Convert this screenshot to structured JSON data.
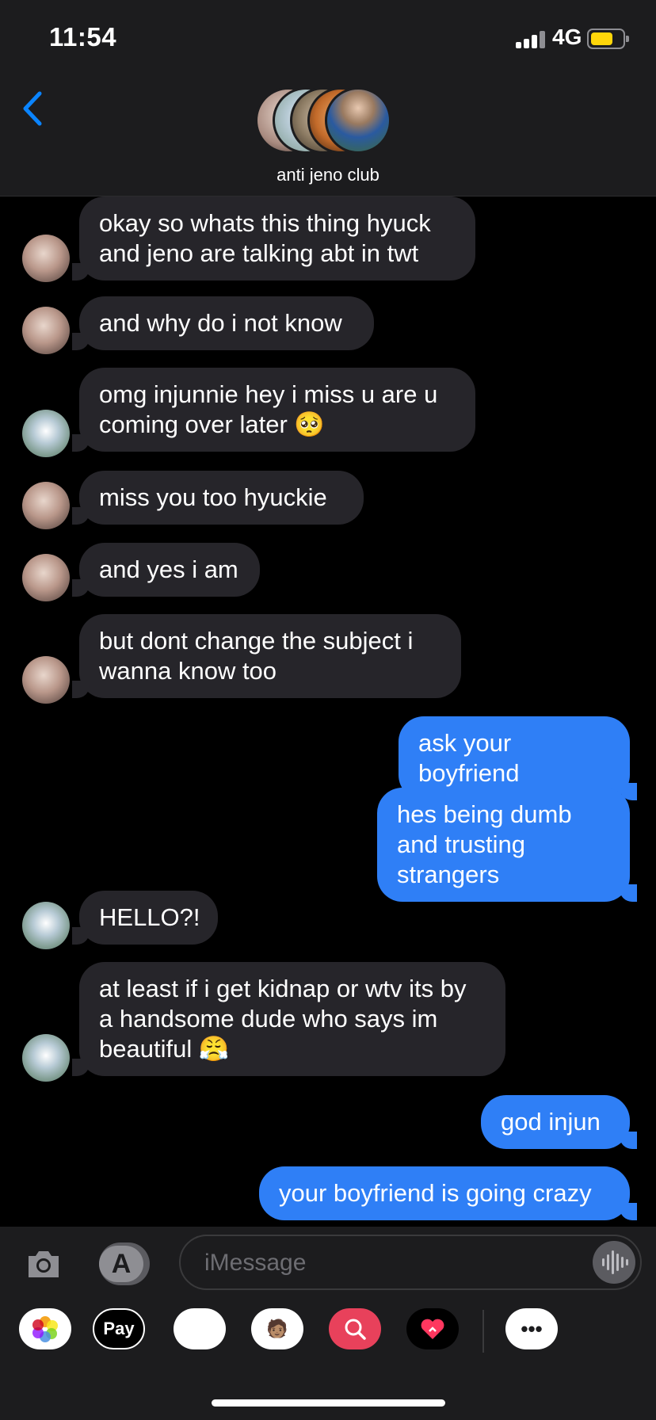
{
  "status": {
    "time": "11:54",
    "network": "4G"
  },
  "header": {
    "group_name": "anti jeno club",
    "back_icon": "chevron-left-icon"
  },
  "messages": [
    {
      "side": "in",
      "text": "okay so whats this thing hyuck and jeno are talking abt in twt",
      "avatar": "a"
    },
    {
      "side": "in",
      "text": "and why do i not know",
      "avatar": "a"
    },
    {
      "side": "in",
      "text": "omg injunnie hey i miss u are u coming over later 🥺",
      "avatar": "b"
    },
    {
      "side": "in",
      "text": "miss you too hyuckie",
      "avatar": "a"
    },
    {
      "side": "in",
      "text": "and yes i am",
      "avatar": "a"
    },
    {
      "side": "in",
      "text": "but dont change the subject i wanna know too",
      "avatar": "a"
    },
    {
      "side": "out",
      "text": "ask your boyfriend"
    },
    {
      "side": "out",
      "text": "hes being dumb and trusting strangers"
    },
    {
      "side": "in",
      "text": "HELLO?!",
      "avatar": "b"
    },
    {
      "side": "in",
      "text": "at least if i get kidnap or wtv its by a handsome dude who says im beautiful 😤",
      "avatar": "b"
    },
    {
      "side": "out",
      "text": "god injun"
    },
    {
      "side": "out",
      "text": "your boyfriend is going crazy"
    }
  ],
  "composer": {
    "placeholder": "iMessage",
    "camera_icon": "camera-icon",
    "appstore_icon": "app-store-icon",
    "audio_icon": "audio-waveform-icon"
  },
  "app_drawer": [
    {
      "name": "photos-app-icon",
      "label": ""
    },
    {
      "name": "apple-pay-icon",
      "label": " Pay"
    },
    {
      "name": "animoji-icon",
      "label": "🐵"
    },
    {
      "name": "memoji-stickers-icon",
      "label": "🧑🏽"
    },
    {
      "name": "image-search-icon",
      "label": ""
    },
    {
      "name": "digital-touch-icon",
      "label": ""
    },
    {
      "name": "more-apps-icon",
      "label": "•••"
    }
  ],
  "colors": {
    "incoming_bubble": "#26252a",
    "outgoing_bubble": "#2f7ff6",
    "accent": "#0a84ff",
    "background": "#000000"
  }
}
